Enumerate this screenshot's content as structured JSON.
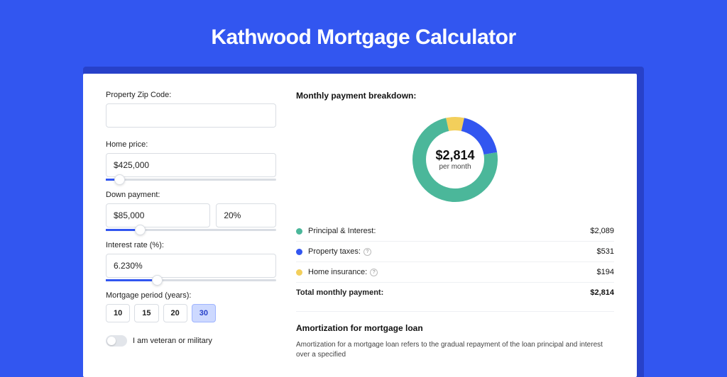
{
  "title": "Kathwood Mortgage Calculator",
  "form": {
    "zip": {
      "label": "Property Zip Code:",
      "value": ""
    },
    "price": {
      "label": "Home price:",
      "value": "$425,000",
      "slider_pct": 8
    },
    "down": {
      "label": "Down payment:",
      "amount": "$85,000",
      "pct": "20%",
      "slider_pct": 20
    },
    "rate": {
      "label": "Interest rate (%):",
      "value": "6.230%",
      "slider_pct": 30
    },
    "period": {
      "label": "Mortgage period (years):",
      "options": [
        "10",
        "15",
        "20",
        "30"
      ],
      "selected": "30"
    },
    "veteran": {
      "label": "I am veteran or military",
      "checked": false
    }
  },
  "breakdown": {
    "title": "Monthly payment breakdown:",
    "center_value": "$2,814",
    "center_sub": "per month",
    "items": [
      {
        "label": "Principal & Interest:",
        "value": "$2,089",
        "color": "#4bb79a",
        "info": false
      },
      {
        "label": "Property taxes:",
        "value": "$531",
        "color": "#3256f0",
        "info": true
      },
      {
        "label": "Home insurance:",
        "value": "$194",
        "color": "#f3cf5b",
        "info": true
      }
    ],
    "total_label": "Total monthly payment:",
    "total_value": "$2,814"
  },
  "chart_data": {
    "type": "pie",
    "title": "Monthly payment breakdown",
    "series": [
      {
        "name": "Principal & Interest",
        "value": 2089,
        "color": "#4bb79a"
      },
      {
        "name": "Property taxes",
        "value": 531,
        "color": "#3256f0"
      },
      {
        "name": "Home insurance",
        "value": 194,
        "color": "#f3cf5b"
      }
    ],
    "total": 2814,
    "center_label": "$2,814 per month"
  },
  "amortization": {
    "title": "Amortization for mortgage loan",
    "text": "Amortization for a mortgage loan refers to the gradual repayment of the loan principal and interest over a specified"
  }
}
